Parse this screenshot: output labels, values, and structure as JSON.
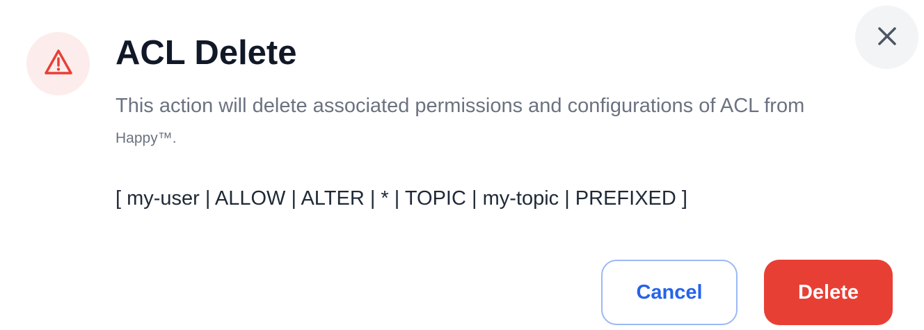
{
  "dialog": {
    "title": "ACL Delete",
    "description": "This action will delete associated permissions and configurations of ACL from",
    "trade_name": "Happy™.",
    "acl_summary": "[ my-user | ALLOW | ALTER | * | TOPIC | my-topic | PREFIXED ]",
    "icons": {
      "warning": "warning-triangle-icon",
      "close": "close-icon"
    },
    "buttons": {
      "cancel_label": "Cancel",
      "delete_label": "Delete"
    }
  },
  "colors": {
    "danger": "#e83f35",
    "danger_light": "#fdecec",
    "primary": "#2563eb",
    "title": "#111827",
    "muted_text": "#6b7280",
    "body_text": "#1f2937"
  }
}
